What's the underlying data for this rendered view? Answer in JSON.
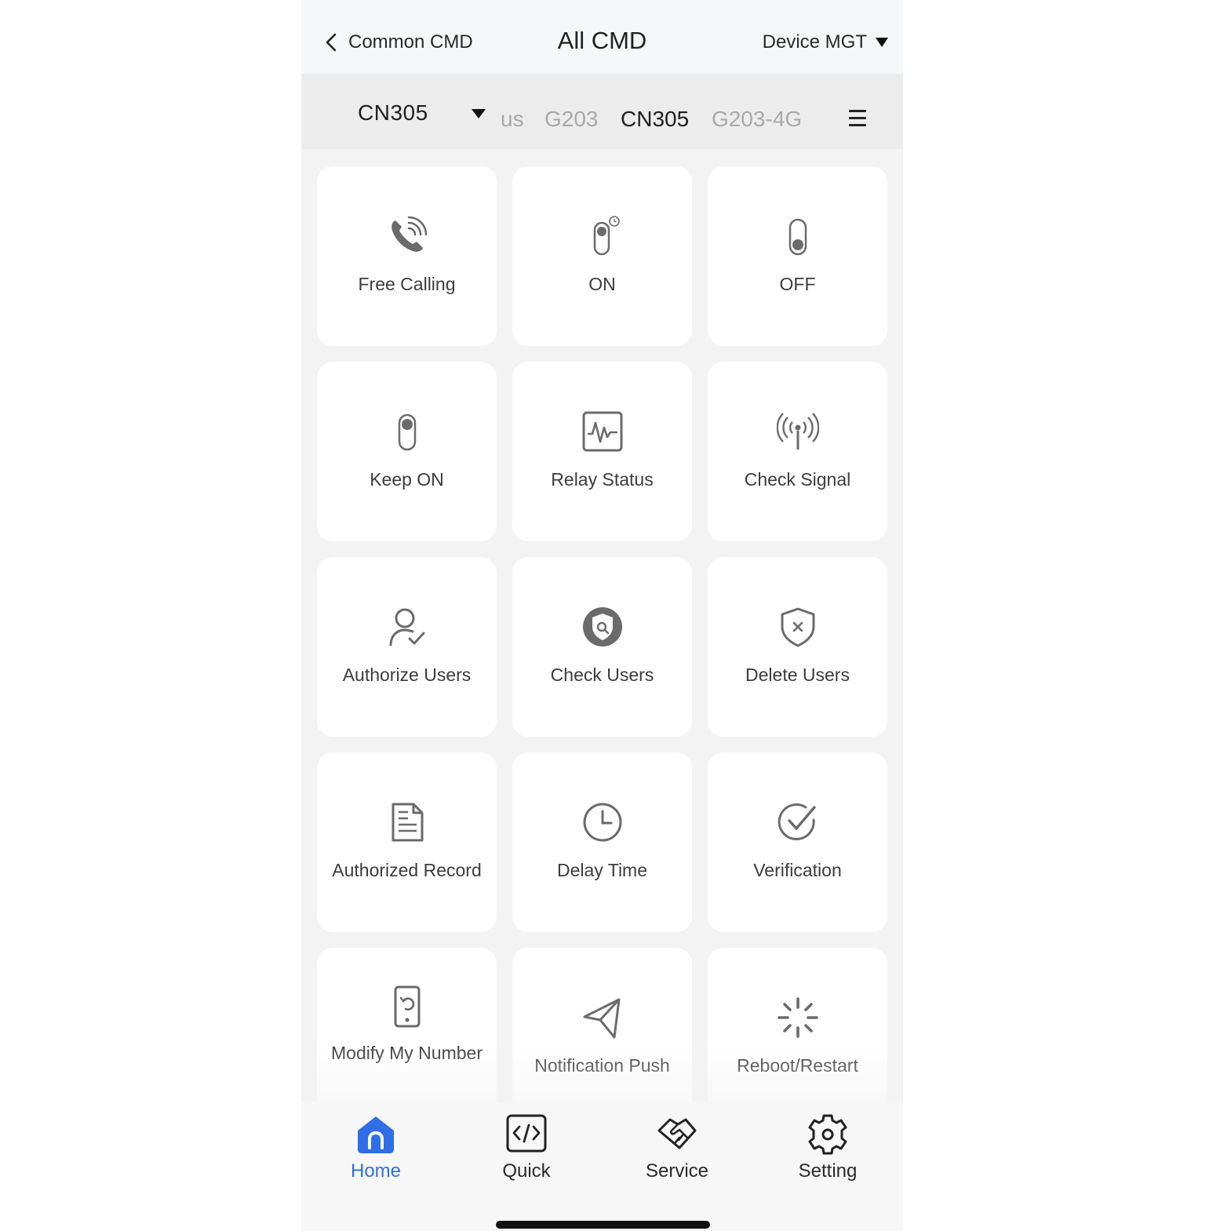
{
  "header": {
    "back_label": "Common CMD",
    "title": "All CMD",
    "manage_label": "Device MGT"
  },
  "devices": {
    "selected": "CN305",
    "tabs": [
      {
        "label": "us",
        "active": false
      },
      {
        "label": "G203",
        "active": false
      },
      {
        "label": "CN305",
        "active": true
      },
      {
        "label": "G203-4G",
        "active": false
      }
    ]
  },
  "commands": [
    {
      "label": "Free Calling",
      "icon": "phone-call-icon"
    },
    {
      "label": "ON",
      "icon": "switch-on-timer-icon"
    },
    {
      "label": "OFF",
      "icon": "switch-off-icon"
    },
    {
      "label": "Keep ON",
      "icon": "switch-on-icon"
    },
    {
      "label": "Relay Status",
      "icon": "pulse-monitor-icon"
    },
    {
      "label": "Check Signal",
      "icon": "antenna-signal-icon"
    },
    {
      "label": "Authorize Users",
      "icon": "user-check-icon"
    },
    {
      "label": "Check Users",
      "icon": "shield-search-icon"
    },
    {
      "label": "Delete Users",
      "icon": "shield-x-icon"
    },
    {
      "label": "Authorized Record",
      "icon": "document-icon"
    },
    {
      "label": "Delay Time",
      "icon": "clock-icon"
    },
    {
      "label": "Verification",
      "icon": "check-circle-icon"
    },
    {
      "label": "Modify My Number",
      "icon": "phone-refresh-icon"
    },
    {
      "label": "Notification Push",
      "icon": "send-icon"
    },
    {
      "label": "Reboot/Restart",
      "icon": "spinner-icon"
    }
  ],
  "tabbar": {
    "tabs": [
      {
        "label": "Home",
        "icon": "home-icon",
        "active": true
      },
      {
        "label": "Quick",
        "icon": "code-icon",
        "active": false
      },
      {
        "label": "Service",
        "icon": "handshake-icon",
        "active": false
      },
      {
        "label": "Setting",
        "icon": "gear-icon",
        "active": false
      }
    ]
  },
  "colors": {
    "accent": "#2f6ee5",
    "icon_gray": "#6b6b6b",
    "background": "#f3f3f3",
    "card": "#ffffff"
  }
}
